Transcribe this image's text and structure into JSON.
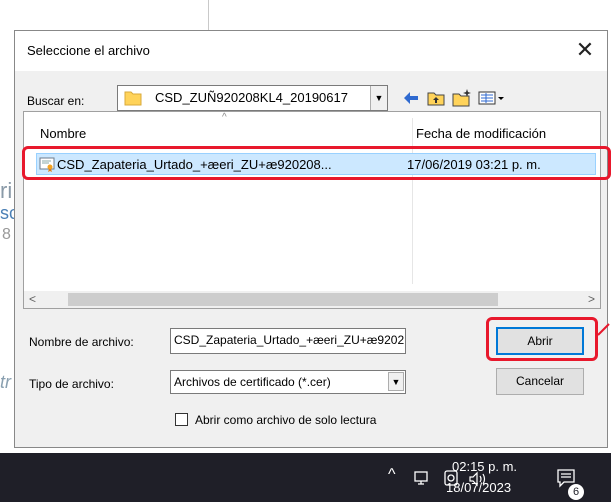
{
  "dialog": {
    "title": "Seleccione el archivo",
    "close_glyph": "✕",
    "look_in_label": "Buscar en:",
    "look_in_value": "CSD_ZUÑ920208KL4_20190617",
    "toolbar_icons": [
      "back-icon",
      "up-folder-icon",
      "new-folder-icon",
      "view-menu-icon"
    ],
    "columns": [
      "Nombre",
      "Fecha de modificación"
    ],
    "files": [
      {
        "name": "CSD_Zapateria_Urtado_+æeri_ZU+æ920208...",
        "modified": "17/06/2019 03:21 p. m."
      }
    ],
    "file_name_label": "Nombre de archivo:",
    "file_name_value": "CSD_Zapateria_Urtado_+æeri_ZU+æ9202",
    "file_type_label": "Tipo de archivo:",
    "file_type_value": "Archivos de certificado (*.cer)",
    "open_button": "Abrir",
    "cancel_button": "Cancelar",
    "readonly_checkbox_label": "Abrir como archivo de solo lectura",
    "readonly_checked": false
  },
  "taskbar": {
    "time": "02:15 p. m.",
    "date": "18/07/2023",
    "notification_count": "6",
    "tray_icons": [
      "chevron-up-icon",
      "network-icon",
      "onedrive-icon",
      "volume-icon",
      "notification-icon"
    ]
  },
  "colors": {
    "annotation": "#e8182c",
    "selection": "#cce8ff",
    "taskbar": "#1f1f28",
    "default_button_border": "#0078d7"
  }
}
